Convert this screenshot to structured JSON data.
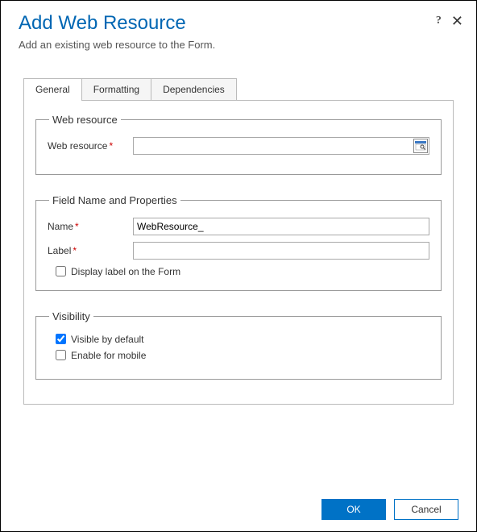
{
  "header": {
    "title": "Add Web Resource",
    "subtitle": "Add an existing web resource to the Form."
  },
  "tabs": [
    {
      "label": "General",
      "active": true
    },
    {
      "label": "Formatting",
      "active": false
    },
    {
      "label": "Dependencies",
      "active": false
    }
  ],
  "sections": {
    "webresource": {
      "legend": "Web resource",
      "field_label": "Web resource",
      "value": ""
    },
    "properties": {
      "legend": "Field Name and Properties",
      "name_label": "Name",
      "name_value": "WebResource_",
      "label_label": "Label",
      "label_value": "",
      "display_checkbox_label": "Display label on the Form",
      "display_checked": false
    },
    "visibility": {
      "legend": "Visibility",
      "visible_label": "Visible by default",
      "visible_checked": true,
      "mobile_label": "Enable for mobile",
      "mobile_checked": false
    }
  },
  "buttons": {
    "ok": "OK",
    "cancel": "Cancel"
  }
}
